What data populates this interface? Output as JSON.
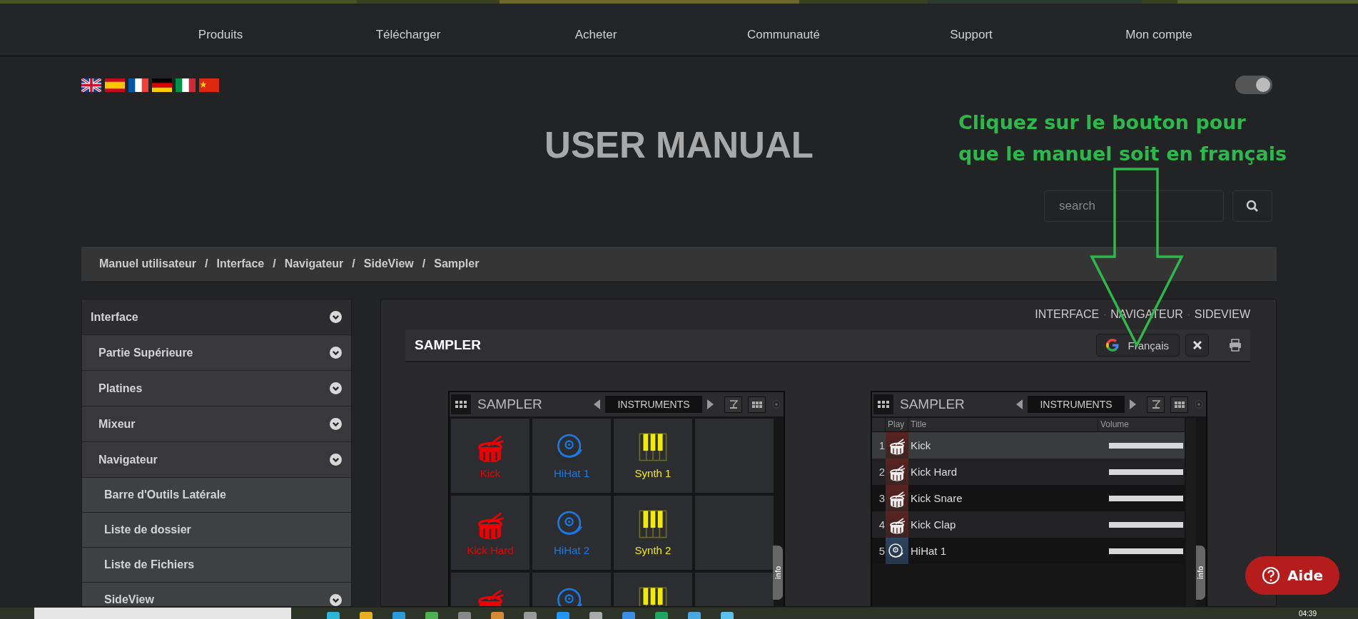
{
  "nav": [
    "Produits",
    "Télécharger",
    "Acheter",
    "Communauté",
    "Support",
    "Mon compte"
  ],
  "theme_toggle": {
    "on": true
  },
  "title": "USER MANUAL",
  "annotation": {
    "lines": [
      "Cliquez sur le bouton pour",
      "que le manuel soit en français"
    ]
  },
  "search": {
    "placeholder": "search"
  },
  "breadcrumb": {
    "separator": "/",
    "items": [
      "Manuel utilisateur",
      "Interface",
      "Navigateur",
      "SideView",
      "Sampler"
    ]
  },
  "sidebar": {
    "items": [
      {
        "label": "Interface",
        "expandable": true,
        "children": [
          {
            "label": "Partie Supérieure",
            "expandable": true
          },
          {
            "label": "Platines",
            "expandable": true
          },
          {
            "label": "Mixeur",
            "expandable": true
          },
          {
            "label": "Navigateur",
            "expandable": true,
            "children": [
              {
                "label": "Barre d'Outils Latérale",
                "expandable": false
              },
              {
                "label": "Liste de dossier",
                "expandable": false
              },
              {
                "label": "Liste de Fichiers",
                "expandable": false
              },
              {
                "label": "SideView",
                "expandable": true
              }
            ]
          }
        ]
      }
    ]
  },
  "content": {
    "path_links": [
      "INTERFACE",
      "NAVIGATEUR",
      "SIDEVIEW"
    ],
    "path_separator": "-",
    "heading": "SAMPLER",
    "translate_button": "Français"
  },
  "sampler_pads": {
    "title": "SAMPLER",
    "bank": "INSTRUMENTS",
    "info_tab": "info",
    "pads": [
      {
        "kind": "drum",
        "label": "Kick"
      },
      {
        "kind": "cymbal",
        "label": "HiHat 1"
      },
      {
        "kind": "keys",
        "label": "Synth 1"
      },
      {
        "kind": "empty"
      },
      {
        "kind": "drum",
        "label": "Kick Hard"
      },
      {
        "kind": "cymbal",
        "label": "HiHat 2"
      },
      {
        "kind": "keys",
        "label": "Synth 2"
      },
      {
        "kind": "empty"
      },
      {
        "kind": "drum"
      },
      {
        "kind": "cymbal"
      },
      {
        "kind": "keys"
      },
      {
        "kind": "empty"
      }
    ]
  },
  "sampler_list": {
    "title": "SAMPLER",
    "bank": "INSTRUMENTS",
    "info_tab": "info",
    "columns": [
      "Play",
      "Title",
      "Volume"
    ],
    "rows": [
      {
        "number": "1",
        "kind": "drum",
        "title": "Kick",
        "level": 1,
        "selected": true
      },
      {
        "number": "2",
        "kind": "drum",
        "title": "Kick Hard",
        "level": 1,
        "selected": false
      },
      {
        "number": "3",
        "kind": "drum",
        "title": "Kick Snare",
        "level": 1,
        "selected": false
      },
      {
        "number": "4",
        "kind": "drum",
        "title": "Kick Clap",
        "level": 1,
        "selected": false
      },
      {
        "number": "5",
        "kind": "cymbal",
        "title": "HiHat 1",
        "level": 1,
        "selected": false
      }
    ]
  },
  "help_button": "Aide",
  "taskbar": {
    "clock": "04:39"
  }
}
